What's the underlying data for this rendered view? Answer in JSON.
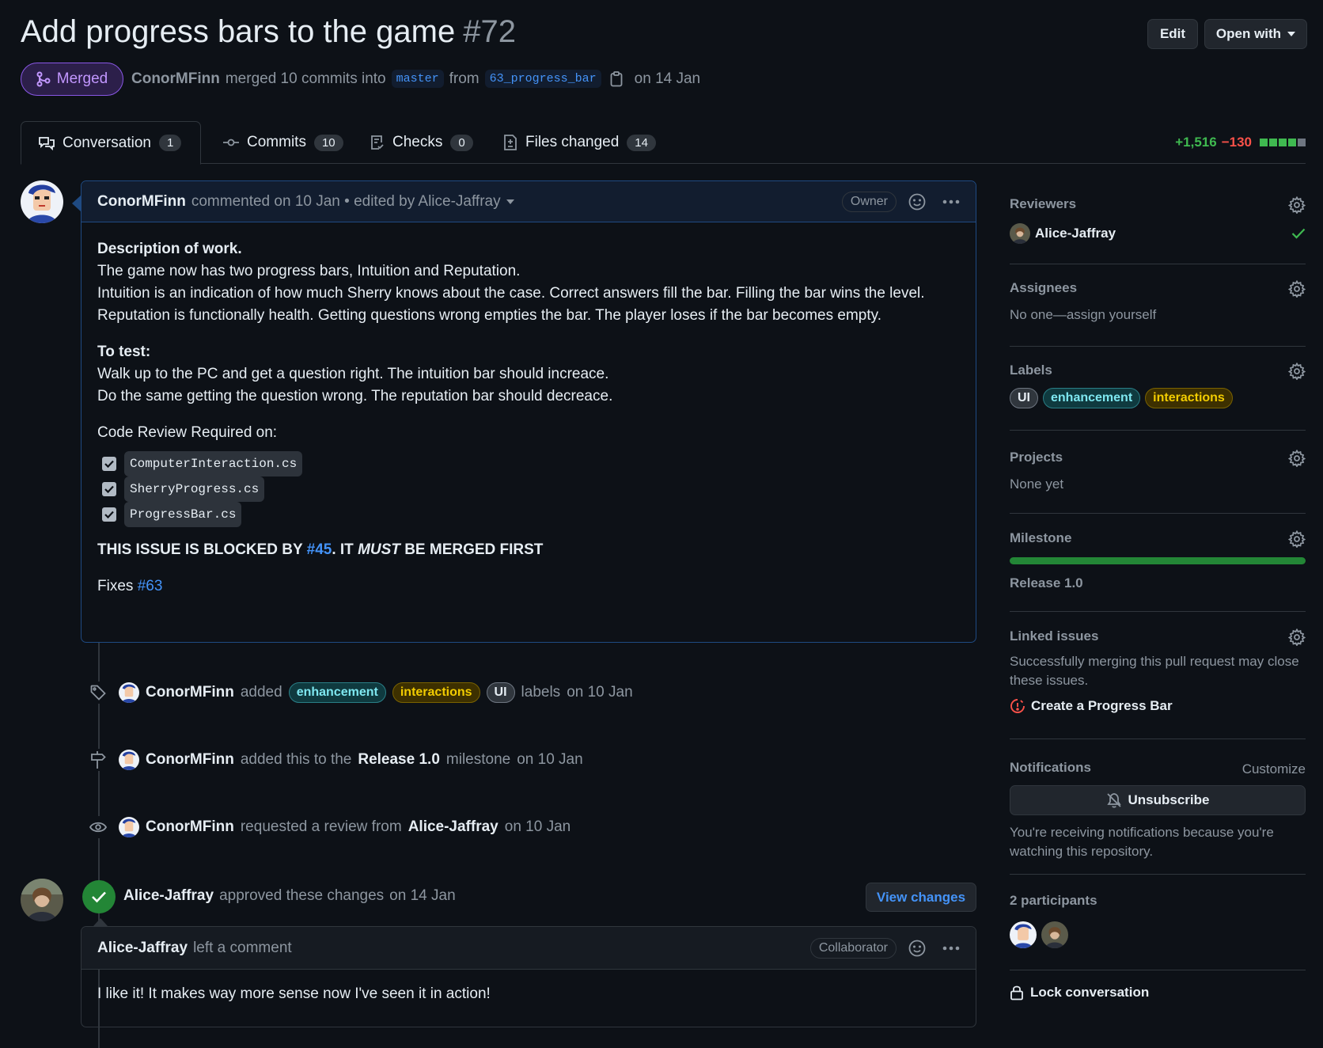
{
  "header": {
    "title": "Add progress bars to the game",
    "number": "#72",
    "edit_label": "Edit",
    "open_with_label": "Open with",
    "status": "Merged",
    "author": "ConorMFinn",
    "merged_text": "merged 10 commits into",
    "base_branch": "master",
    "from_text": "from",
    "head_branch": "63_progress_bar",
    "date_text": "on 14 Jan"
  },
  "tabs": [
    {
      "label": "Conversation",
      "count": "1"
    },
    {
      "label": "Commits",
      "count": "10"
    },
    {
      "label": "Checks",
      "count": "0"
    },
    {
      "label": "Files changed",
      "count": "14"
    }
  ],
  "diffstat": {
    "additions": "+1,516",
    "deletions": "−130",
    "colors": [
      "#3fb950",
      "#3fb950",
      "#3fb950",
      "#3fb950",
      "#6e7681"
    ]
  },
  "main_comment": {
    "author": "ConorMFinn",
    "meta": "commented on 10 Jan • edited by Alice-Jaffray",
    "role": "Owner",
    "desc_heading": "Description of work.",
    "desc_lines": [
      "The game now has two progress bars, Intuition and Reputation.",
      "Intuition is an indication of how much Sherry knows about the case. Correct answers fill the bar. Filling the bar wins the level.",
      "Reputation is functionally health. Getting questions wrong empties the bar. The player loses if the bar becomes empty."
    ],
    "test_heading": "To test:",
    "test_lines": [
      "Walk up to the PC and get a question right. The intuition bar should increace.",
      "Do the same getting the question wrong. The reputation bar should decreace."
    ],
    "review_heading": "Code Review Required on:",
    "tasks": [
      "ComputerInteraction.cs",
      "SherryProgress.cs",
      "ProgressBar.cs"
    ],
    "blocked_pre": "THIS ISSUE IS BLOCKED BY",
    "blocked_link": "#45",
    "blocked_mid": ". IT",
    "blocked_em": "MUST",
    "blocked_post": "BE MERGED FIRST",
    "fixes_text": "Fixes",
    "fixes_link": "#63"
  },
  "timeline": {
    "labels_event": {
      "author": "ConorMFinn",
      "action": "added",
      "labels": [
        "enhancement",
        "interactions",
        "UI"
      ],
      "suffix": "labels",
      "date": "on 10 Jan"
    },
    "milestone_event": {
      "author": "ConorMFinn",
      "action": "added this to the",
      "milestone": "Release 1.0",
      "suffix": "milestone",
      "date": "on 10 Jan"
    },
    "review_event": {
      "author": "ConorMFinn",
      "action": "requested a review from",
      "reviewer": "Alice-Jaffray",
      "date": "on 10 Jan"
    },
    "approval_event": {
      "author": "Alice-Jaffray",
      "action": "approved these changes",
      "date": "on 14 Jan",
      "button": "View changes"
    }
  },
  "review_comment": {
    "author": "Alice-Jaffray",
    "meta": "left a comment",
    "role": "Collaborator",
    "body": "I like it! It makes way more sense now I've seen it in action!"
  },
  "sidebar": {
    "reviewers": {
      "title": "Reviewers",
      "name": "Alice-Jaffray"
    },
    "assignees": {
      "title": "Assignees",
      "text": "No one—assign yourself"
    },
    "labels": {
      "title": "Labels",
      "items": [
        "UI",
        "enhancement",
        "interactions"
      ]
    },
    "projects": {
      "title": "Projects",
      "text": "None yet"
    },
    "milestone": {
      "title": "Milestone",
      "name": "Release 1.0",
      "progress": 1.0
    },
    "linked": {
      "title": "Linked issues",
      "text": "Successfully merging this pull request may close these issues.",
      "issue": "Create a Progress Bar"
    },
    "notifications": {
      "title": "Notifications",
      "customize": "Customize",
      "button": "Unsubscribe",
      "text": "You're receiving notifications because you're watching this repository."
    },
    "participants": {
      "title": "2 participants"
    },
    "lock": "Lock conversation"
  }
}
